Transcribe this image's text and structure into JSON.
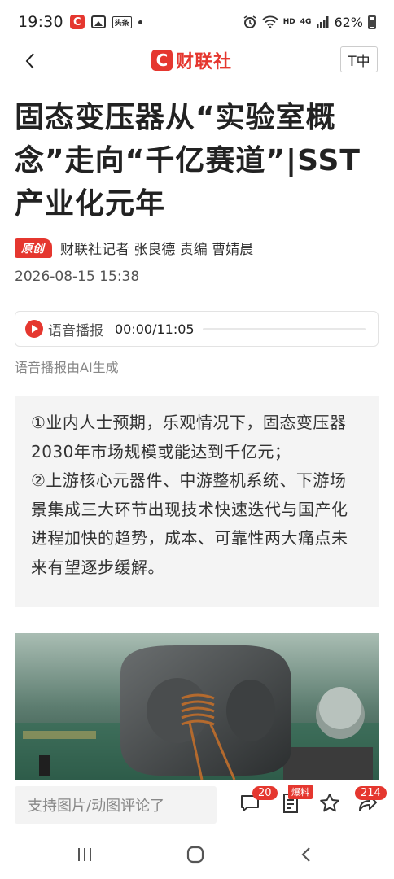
{
  "status_bar": {
    "time": "19:30",
    "toutiao_label": "头条",
    "network_label": "HD",
    "signal_label": "4G",
    "battery": "62%"
  },
  "header": {
    "logo_mark": "C",
    "logo_text": "财联社",
    "font_button_label": "T中"
  },
  "article": {
    "title": "固态变压器从“实验室概念”走向“千亿赛道”|SST产业化元年",
    "original_tag": "原创",
    "author": "财联社记者 张良德  责编 曹婧晨",
    "date": "2026-08-15 15:38",
    "audio_label": "语音播报",
    "audio_time": "00:00/11:05",
    "ai_note": "语音播报由AI生成",
    "summary": [
      "①业内人士预期，乐观情况下，固态变压器2030年市场规模或能达到千亿元；",
      "②上游核心元器件、中游整机系统、下游场景集成三大环节出现技术快速迭代与国产化进程加快的趋势，成本、可靠性两大痛点未来有望逐步缓解。"
    ]
  },
  "bottom_bar": {
    "comment_placeholder": "支持图片/动图评论了",
    "comment_count": "20",
    "report_label": "爆料",
    "share_count": "214"
  },
  "colors": {
    "brand_red": "#e5372f",
    "summary_bg": "#f4f4f4"
  }
}
